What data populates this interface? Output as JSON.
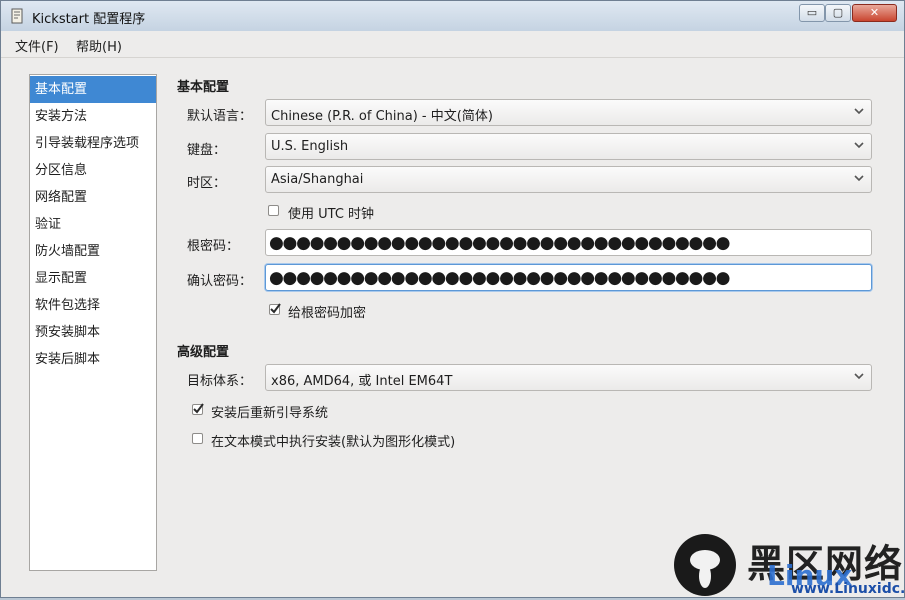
{
  "window": {
    "title": "Kickstart 配置程序",
    "controls": {
      "minimize": "▭",
      "maximize": "▢",
      "close": "✕"
    }
  },
  "menubar": {
    "file": "文件(F)",
    "help": "帮助(H)"
  },
  "sidebar": {
    "items": [
      {
        "label": "基本配置",
        "selected": true
      },
      {
        "label": "安装方法"
      },
      {
        "label": "引导装载程序选项"
      },
      {
        "label": "分区信息"
      },
      {
        "label": "网络配置"
      },
      {
        "label": "验证"
      },
      {
        "label": "防火墙配置"
      },
      {
        "label": "显示配置"
      },
      {
        "label": "软件包选择"
      },
      {
        "label": "预安装脚本"
      },
      {
        "label": "安装后脚本"
      }
    ]
  },
  "basic": {
    "title": "基本配置",
    "language_label": "默认语言：",
    "language_value": "Chinese (P.R. of China) - 中文(简体)",
    "keyboard_label": "键盘：",
    "keyboard_value": "U.S. English",
    "timezone_label": "时区：",
    "timezone_value": "Asia/Shanghai",
    "utc_label": "使用  UTC 时钟",
    "utc_checked": false,
    "root_password_label": "根密码：",
    "root_password_value": "●●●●●●●●●●●●●●●●●●●●●●●●●●●●●●●●●●",
    "confirm_password_label": "确认密码：",
    "confirm_password_value": "●●●●●●●●●●●●●●●●●●●●●●●●●●●●●●●●●●",
    "encrypt_label": "给根密码加密",
    "encrypt_checked": true
  },
  "advanced": {
    "title": "高级配置",
    "arch_label": "目标体系：",
    "arch_value": "x86, AMD64, 或  Intel EM64T",
    "reboot_label": "安装后重新引导系统",
    "reboot_checked": true,
    "textmode_label": "在文本模式中执行安装(默认为图形化模式)",
    "textmode_checked": false
  },
  "watermark": {
    "brand_cn": "黑区网络",
    "brand_latin": "Linux",
    "url": "www.Linuxidc.com"
  },
  "colors": {
    "selection": "#3f88d3",
    "window_bg": "#edeceb",
    "focus_border": "#5d98d6"
  }
}
